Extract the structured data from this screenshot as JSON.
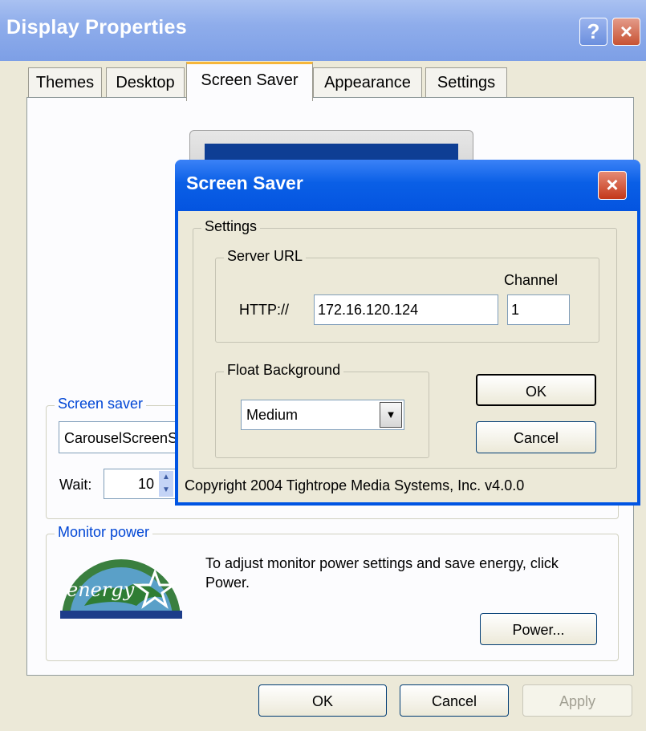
{
  "window": {
    "title": "Display Properties",
    "help_btn": "?",
    "close_btn": "×"
  },
  "tabs": [
    {
      "label": "Themes"
    },
    {
      "label": "Desktop"
    },
    {
      "label": "Screen Saver"
    },
    {
      "label": "Appearance"
    },
    {
      "label": "Settings"
    }
  ],
  "screen_saver_group": {
    "label": "Screen saver",
    "selected": "CarouselScreenSaver",
    "wait_label": "Wait:",
    "wait_value": "10"
  },
  "monitor_power_group": {
    "label": "Monitor power",
    "text": "To adjust monitor power settings and save energy, click Power.",
    "power_button": "Power..."
  },
  "footer": {
    "ok": "OK",
    "cancel": "Cancel",
    "apply": "Apply"
  },
  "dialog": {
    "title": "Screen Saver",
    "close_btn": "×",
    "settings_label": "Settings",
    "server_url_label": "Server URL",
    "channel_label": "Channel",
    "http_label": "HTTP://",
    "url_value": "172.16.120.124",
    "channel_value": "1",
    "float_bg_label": "Float Background",
    "float_bg_value": "Medium",
    "ok": "OK",
    "cancel": "Cancel",
    "copyright": "Copyright 2004 Tightrope Media Systems, Inc.  v4.0.0"
  }
}
